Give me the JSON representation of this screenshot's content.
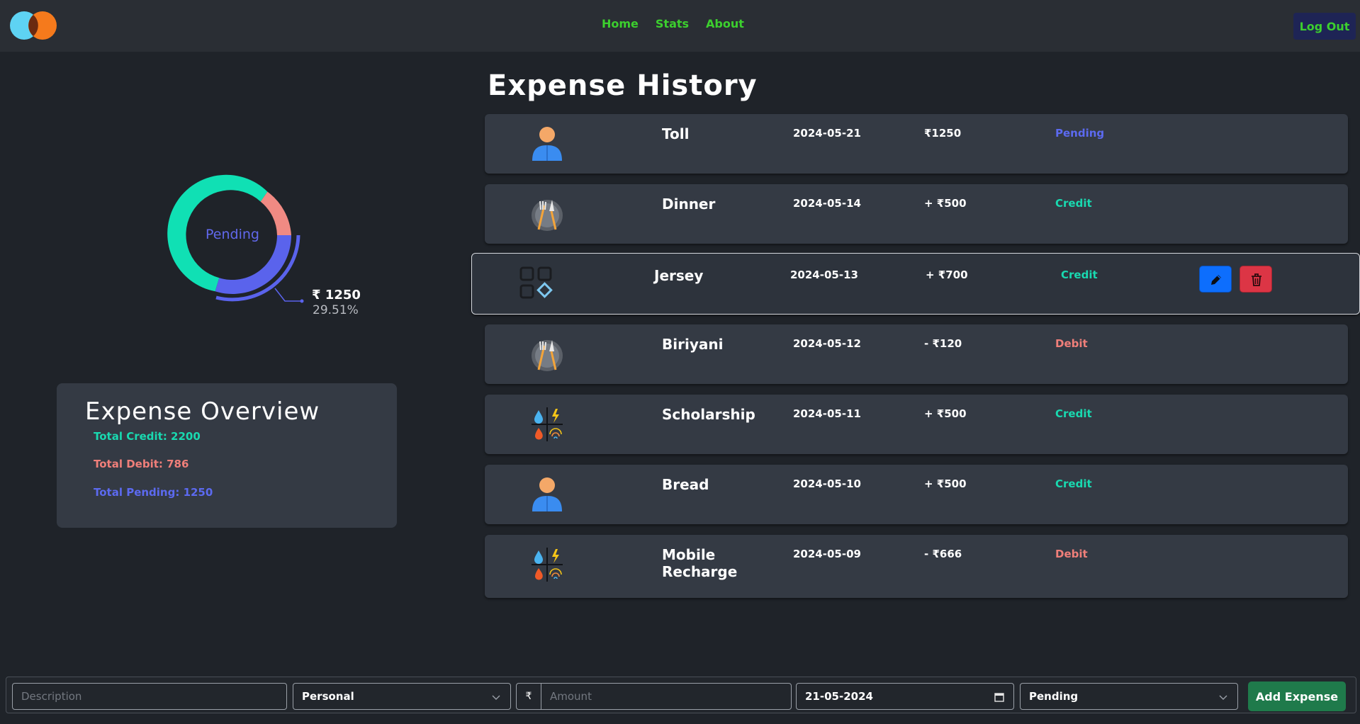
{
  "nav": {
    "links": [
      "Home",
      "Stats",
      "About"
    ],
    "logout_label": "Log Out"
  },
  "donut": {
    "center_label": "Pending",
    "value": "₹ 1250",
    "percent": "29.51%",
    "colors": {
      "credit": "#10e0b4",
      "debit": "#f08a83",
      "pending": "#5a63ec"
    }
  },
  "overview": {
    "title": "Expense Overview",
    "credit": "Total Credit: 2200",
    "debit": "Total Debit: 786",
    "pending": "Total Pending: 1250"
  },
  "history": {
    "title": "Expense History",
    "rows": [
      {
        "name": "Toll",
        "date": "2024-05-21",
        "amount": "₹1250",
        "status": "Pending",
        "icon": "person-icon"
      },
      {
        "name": "Dinner",
        "date": "2024-05-14",
        "amount": "+ ₹500",
        "status": "Credit",
        "icon": "dining-icon"
      },
      {
        "name": "Jersey",
        "date": "2024-05-13",
        "amount": "+ ₹700",
        "status": "Credit",
        "icon": "categories-icon"
      },
      {
        "name": "Biriyani",
        "date": "2024-05-12",
        "amount": "- ₹120",
        "status": "Debit",
        "icon": "dining-icon"
      },
      {
        "name": "Scholarship",
        "date": "2024-05-11",
        "amount": "+ ₹500",
        "status": "Credit",
        "icon": "utilities-icon"
      },
      {
        "name": "Bread",
        "date": "2024-05-10",
        "amount": "+ ₹500",
        "status": "Credit",
        "icon": "person-icon"
      },
      {
        "name": "Mobile Recharge",
        "date": "2024-05-09",
        "amount": "- ₹666",
        "status": "Debit",
        "icon": "utilities-icon"
      }
    ]
  },
  "form": {
    "description_placeholder": "Description",
    "category": "Personal",
    "currency": "₹",
    "amount_placeholder": "Amount",
    "date": "21-05-2024",
    "status": "Pending",
    "add_label": "Add Expense"
  }
}
